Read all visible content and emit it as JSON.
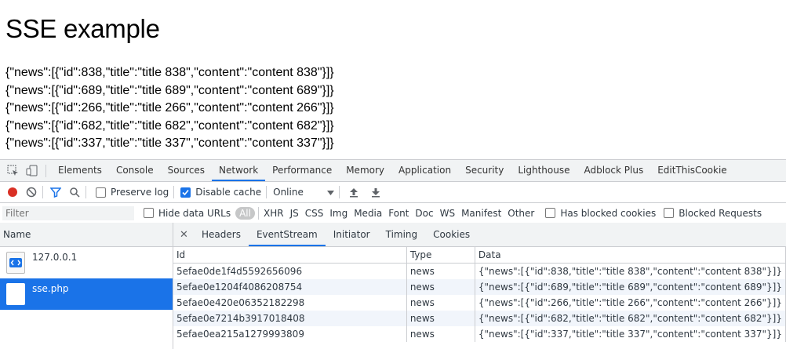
{
  "page": {
    "heading": "SSE example",
    "lines": [
      "{\"news\":[{\"id\":838,\"title\":\"title 838\",\"content\":\"content 838\"}]}",
      "{\"news\":[{\"id\":689,\"title\":\"title 689\",\"content\":\"content 689\"}]}",
      "{\"news\":[{\"id\":266,\"title\":\"title 266\",\"content\":\"content 266\"}]}",
      "{\"news\":[{\"id\":682,\"title\":\"title 682\",\"content\":\"content 682\"}]}",
      "{\"news\":[{\"id\":337,\"title\":\"title 337\",\"content\":\"content 337\"}]}"
    ]
  },
  "devtools": {
    "tabs": [
      "Elements",
      "Console",
      "Sources",
      "Network",
      "Performance",
      "Memory",
      "Application",
      "Security",
      "Lighthouse",
      "Adblock Plus",
      "EditThisCookie"
    ],
    "active_tab": "Network",
    "toolbar": {
      "preserve_log": "Preserve log",
      "disable_cache": "Disable cache",
      "throttle": "Online"
    },
    "filter": {
      "placeholder": "Filter",
      "hide_data_urls": "Hide data URLs",
      "types": [
        "All",
        "XHR",
        "JS",
        "CSS",
        "Img",
        "Media",
        "Font",
        "Doc",
        "WS",
        "Manifest",
        "Other"
      ],
      "has_blocked_cookies": "Has blocked cookies",
      "blocked_requests": "Blocked Requests"
    },
    "names_header": "Name",
    "requests": [
      "127.0.0.1",
      "sse.php"
    ],
    "detail_tabs": [
      "Headers",
      "EventStream",
      "Initiator",
      "Timing",
      "Cookies"
    ],
    "columns": {
      "id": "Id",
      "type": "Type",
      "data": "Data"
    },
    "events": [
      {
        "id": "5efae0de1f4d5592656096",
        "type": "news",
        "data": "{\"news\":[{\"id\":838,\"title\":\"title 838\",\"content\":\"content 838\"}]}"
      },
      {
        "id": "5efae0e1204f4086208754",
        "type": "news",
        "data": "{\"news\":[{\"id\":689,\"title\":\"title 689\",\"content\":\"content 689\"}]}"
      },
      {
        "id": "5efae0e420e06352182298",
        "type": "news",
        "data": "{\"news\":[{\"id\":266,\"title\":\"title 266\",\"content\":\"content 266\"}]}"
      },
      {
        "id": "5efae0e7214b3917018408",
        "type": "news",
        "data": "{\"news\":[{\"id\":682,\"title\":\"title 682\",\"content\":\"content 682\"}]}"
      },
      {
        "id": "5efae0ea215a1279993809",
        "type": "news",
        "data": "{\"news\":[{\"id\":337,\"title\":\"title 337\",\"content\":\"content 337\"}]}"
      }
    ],
    "colors": {
      "accent": "#1a73e8",
      "record": "#d93025"
    }
  }
}
